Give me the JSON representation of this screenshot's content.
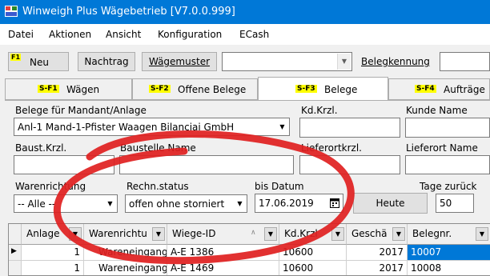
{
  "window": {
    "title": "Winweigh Plus Wägebetrieb [V7.0.0.999]",
    "icon": "scale-app-icon"
  },
  "menu": [
    "Datei",
    "Aktionen",
    "Ansicht",
    "Konfiguration",
    "ECash"
  ],
  "toolbar": {
    "neu_fkey": "F1",
    "neu_label": "Neu",
    "nachtrag_label": "Nachtrag",
    "waegemuster_label": "Wägemuster",
    "waegemuster_value": "",
    "belegkennung_label": "Belegkennung",
    "belegkennung_value": ""
  },
  "tabs": [
    {
      "fkey": "S-F1",
      "label": "Wägen"
    },
    {
      "fkey": "S-F2",
      "label": "Offene Belege"
    },
    {
      "fkey": "S-F3",
      "label": "Belege",
      "active": true
    },
    {
      "fkey": "S-F4",
      "label": "Aufträge"
    }
  ],
  "filters": {
    "mandant_label": "Belege für Mandant/Anlage",
    "mandant_value": "Anl-1 Mand-1-Pfister Waagen Bilanciai GmbH",
    "kdkrzl_label": "Kd.Krzl.",
    "kunde_label": "Kunde Name",
    "baustkrzl_label": "Baust.Krzl.",
    "baustelle_label": "Baustelle Name",
    "lieferortkrzl_label": "Lieferortkrzl.",
    "lieferort_label": "Lieferort Name",
    "warenrichtung_label": "Warenrichtung",
    "warenrichtung_value": "-- Alle --",
    "rechnstatus_label": "Rechn.status",
    "rechnstatus_value": "offen ohne storniert",
    "bisdatum_label": "bis Datum",
    "bisdatum_value": "17.06.2019",
    "heute_label": "Heute",
    "tagezurueck_label": "Tage zurück",
    "tagezurueck_value": "50"
  },
  "grid": {
    "columns": [
      "Anlage",
      "Warenrichtu",
      "Wiege-ID",
      "Kd.Krzl",
      "Geschä",
      "Belegnr."
    ],
    "rows": [
      {
        "anlage": "1",
        "warenrichtung": "Wareneingang",
        "wiege_id": "A-E 1386",
        "kdkrzl": "10600",
        "geschaeft": "2017",
        "belegnr": "10007"
      },
      {
        "anlage": "1",
        "warenrichtung": "Wareneingang",
        "wiege_id": "A-E 1469",
        "kdkrzl": "10600",
        "geschaeft": "2017",
        "belegnr": "10008"
      }
    ]
  },
  "colors": {
    "titlebar": "#0078d7",
    "annotation": "#e02020",
    "fkey": "#ffff00"
  }
}
